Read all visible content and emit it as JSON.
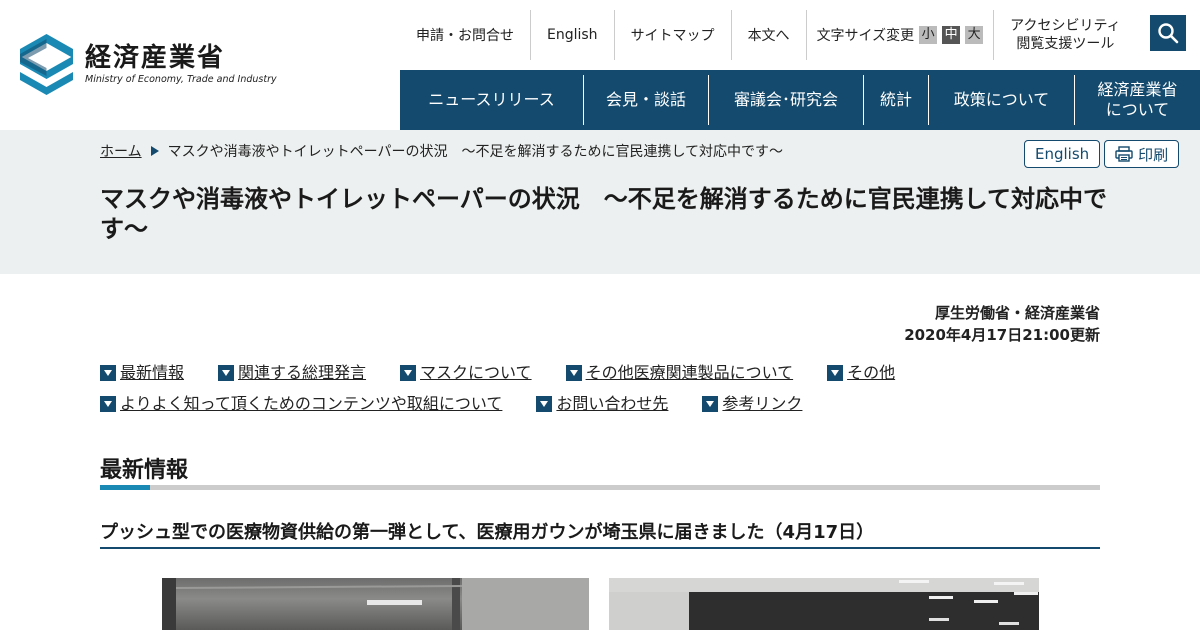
{
  "header": {
    "logo_ja": "経済産業省",
    "logo_en": "Ministry of Economy, Trade and Industry",
    "util": {
      "contact": "申請・お問合せ",
      "english": "English",
      "sitemap": "サイトマップ",
      "body": "本文へ",
      "font_size_label": "文字サイズ変更",
      "font_small": "小",
      "font_medium": "中",
      "font_large": "大",
      "a11y_line1": "アクセシビリティ",
      "a11y_line2": "閲覧支援ツール"
    },
    "search_icon": "search-icon",
    "nav": [
      {
        "label": "ニュースリリース"
      },
      {
        "label": "会見・談話"
      },
      {
        "label": "審議会･研究会"
      },
      {
        "label": "統計"
      },
      {
        "label": "政策について"
      },
      {
        "label": "経済産業省",
        "label2": "について"
      }
    ]
  },
  "breadcrumb": {
    "home": "ホーム",
    "current": "マスクや消毒液やトイレットペーパーの状況　～不足を解消するために官民連携して対応中です～"
  },
  "band_buttons": {
    "english": "English",
    "print": "印刷"
  },
  "page_title": "マスクや消毒液やトイレットペーパーの状況　～不足を解消するために官民連携して対応中です～",
  "meta": {
    "authors": "厚生労働省・経済産業省",
    "updated": "2020年4月17日21:00更新"
  },
  "anchors": [
    [
      "最新情報",
      "関連する総理発言",
      "マスクについて",
      "その他医療関連製品について",
      "その他"
    ],
    [
      "よりよく知って頂くためのコンテンツや取組について",
      "お問い合わせ先",
      "参考リンク"
    ]
  ],
  "section": {
    "title": "最新情報",
    "subtitle": "プッシュ型での医療物資供給の第一弾として、医療用ガウンが埼玉県に届きました（4月17日）"
  },
  "colors": {
    "brand": "#134a6d",
    "accent": "#1a8ab5",
    "band_bg": "#edf0f0"
  }
}
